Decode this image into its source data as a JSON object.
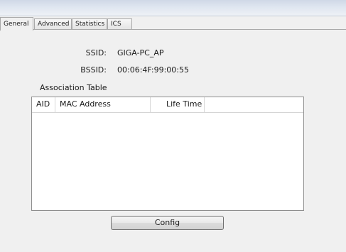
{
  "tabs": [
    {
      "label": "General"
    },
    {
      "label": "Advanced"
    },
    {
      "label": "Statistics"
    },
    {
      "label": "ICS"
    }
  ],
  "general": {
    "ssid_label": "SSID:",
    "ssid_value": "GIGA-PC_AP",
    "bssid_label": "BSSID:",
    "bssid_value": "00:06:4F:99:00:55",
    "association_table_label": "Association Table",
    "table_columns": [
      "AID",
      "MAC Address",
      "Life Time"
    ],
    "table_rows": [],
    "config_button_label": "Config"
  }
}
